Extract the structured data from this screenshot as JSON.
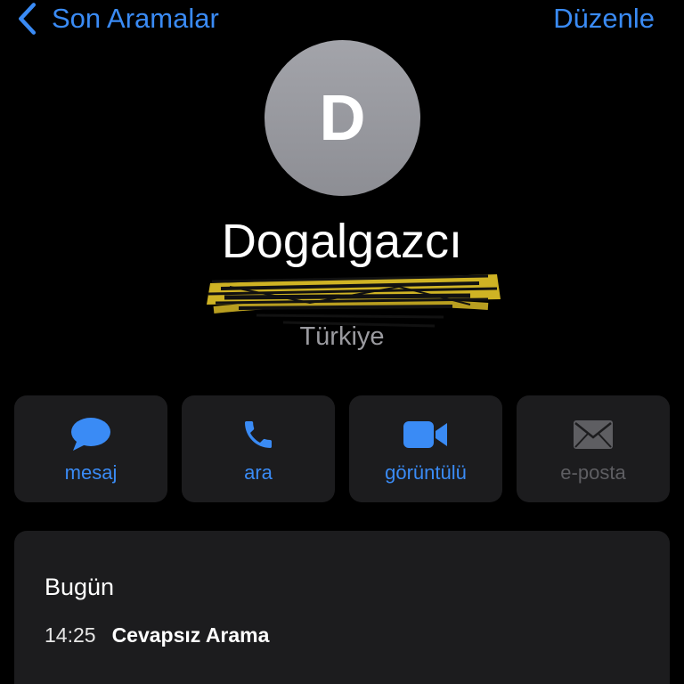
{
  "nav": {
    "back_label": "Son Aramalar",
    "edit_label": "Düzenle"
  },
  "contact": {
    "initial": "D",
    "name": "Dogalgazcı",
    "country": "Türkiye"
  },
  "actions": [
    {
      "label": "mesaj",
      "icon": "message-bubble-icon",
      "enabled": true
    },
    {
      "label": "ara",
      "icon": "phone-icon",
      "enabled": true
    },
    {
      "label": "görüntülü",
      "icon": "video-camera-icon",
      "enabled": true
    },
    {
      "label": "e-posta",
      "icon": "envelope-icon",
      "enabled": false
    }
  ],
  "history": {
    "title": "Bugün",
    "calls": [
      {
        "time": "14:25",
        "status": "Cevapsız Arama"
      }
    ]
  },
  "colors": {
    "accent": "#3a8bf5",
    "card": "#1c1c1e",
    "disabled": "#5e5e62",
    "redaction_highlight": "#e6c628"
  }
}
